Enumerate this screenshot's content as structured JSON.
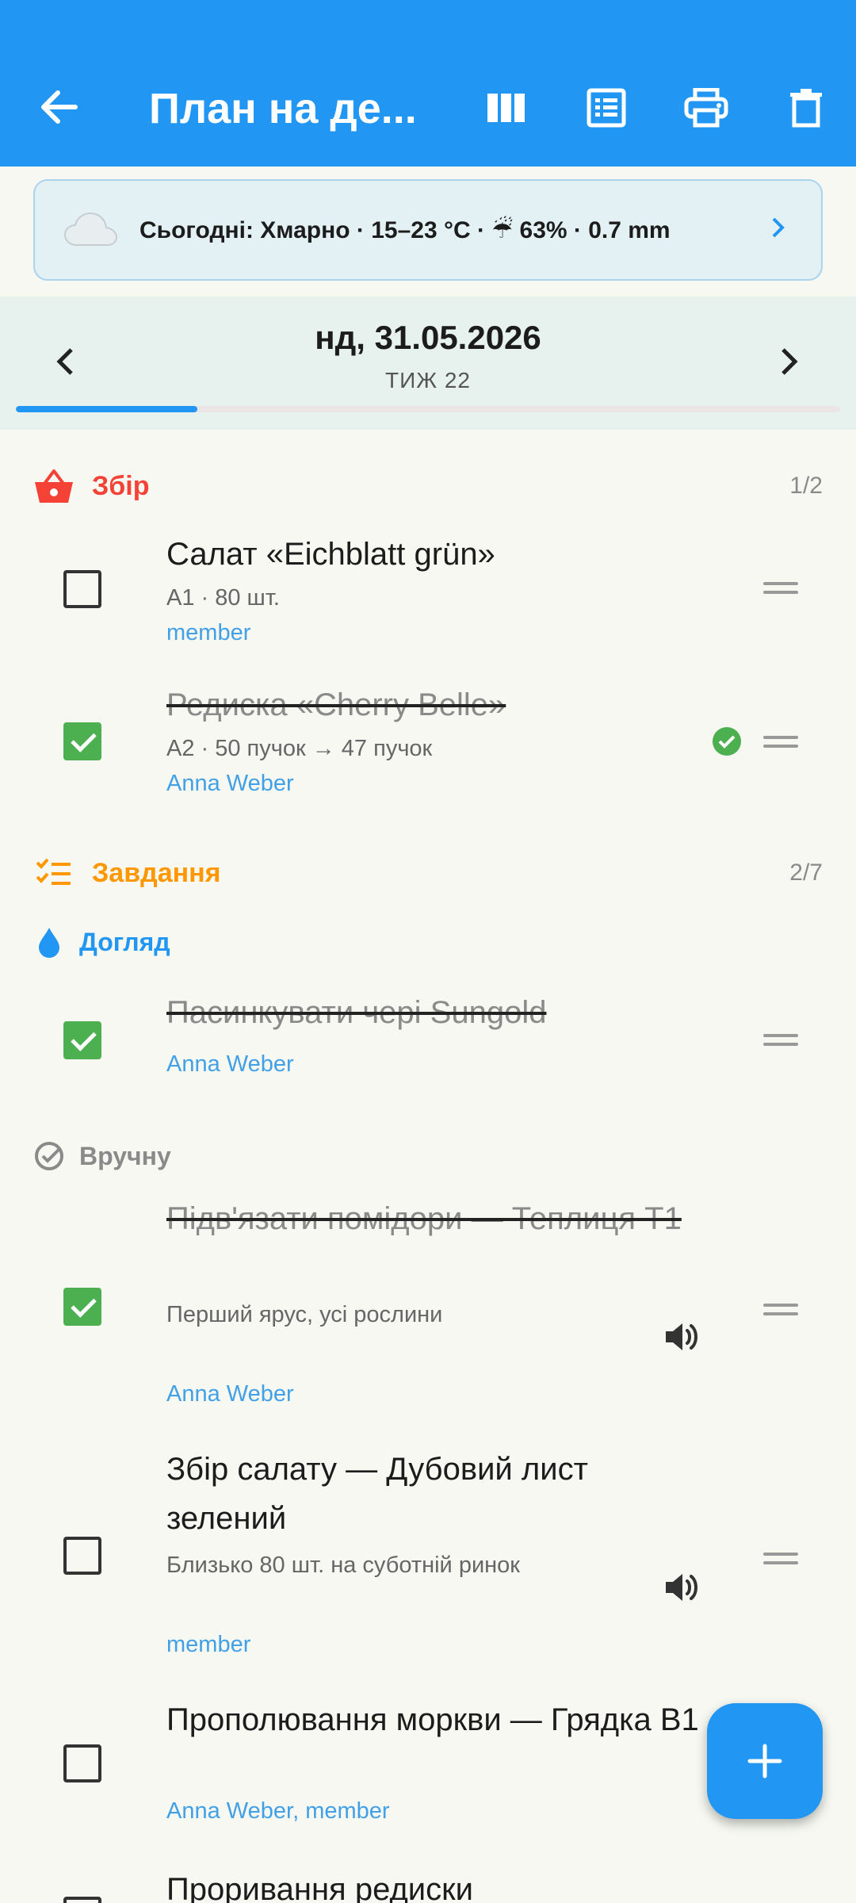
{
  "appbar": {
    "title": "План на де...",
    "actions": [
      "view-columns-icon",
      "list-view-icon",
      "print-icon",
      "delete-icon"
    ]
  },
  "weather": {
    "text": "Сьогодні: Хмарно · 15–23 °C · ☔ 63% · 0.7 mm"
  },
  "date": {
    "label": "нд, 31.05.2026",
    "week": "ТИЖ 22",
    "progress": 0.22
  },
  "harvest": {
    "label": "Збір",
    "count": "1/2",
    "color": "#f44336",
    "items": [
      {
        "title": "Салат «Eichblatt grün»",
        "sub": "A1 · 80 шт.",
        "who": "member",
        "done": false
      },
      {
        "title": "Редиска «Cherry Belle»",
        "sub": "A2 · 50 пучок → 47 пучок",
        "who": "Anna Weber",
        "done": true
      }
    ]
  },
  "tasks": {
    "label": "Завдання",
    "count": "2/7",
    "color": "#ff9800",
    "care": {
      "label": "Догляд",
      "color": "#2196f3",
      "items": [
        {
          "title": "Пасинкувати чері Sungold",
          "who": "Anna Weber",
          "done": true
        }
      ]
    },
    "manual": {
      "label": "Вручну",
      "color": "#8a8a8a",
      "items": [
        {
          "title": "Підв'язати помідори — Теплиця Т1",
          "sub": "Перший ярус, усі рослини",
          "who": "Anna Weber",
          "done": true
        },
        {
          "title": "Збір салату — Дубовий лист зелений",
          "sub": "Близько 80 шт. на суботній ринок",
          "who": "member",
          "done": false
        },
        {
          "title": "Прополювання моркви — Грядка B1",
          "who": "Anna Weber, member",
          "done": false
        },
        {
          "title": "Проривання редиски",
          "done": false
        }
      ]
    }
  }
}
